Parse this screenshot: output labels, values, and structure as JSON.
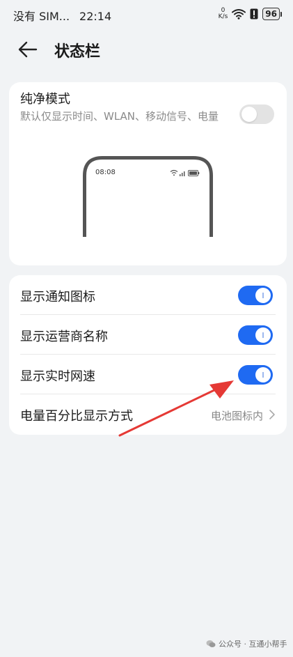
{
  "status_bar": {
    "carrier": "没有 SIM...",
    "time": "22:14",
    "net_speed_value": "0",
    "net_speed_unit": "K/s",
    "battery": "96"
  },
  "header": {
    "title": "状态栏"
  },
  "pure_mode": {
    "title": "纯净模式",
    "description": "默认仅显示时间、WLAN、移动信号、电量",
    "enabled": false,
    "preview_time": "08:08"
  },
  "settings": [
    {
      "label": "显示通知图标",
      "enabled": true
    },
    {
      "label": "显示运营商名称",
      "enabled": true
    },
    {
      "label": "显示实时网速",
      "enabled": true
    }
  ],
  "battery_display": {
    "label": "电量百分比显示方式",
    "value": "电池图标内"
  },
  "watermark": {
    "text": "公众号 · 互通小帮手"
  },
  "colors": {
    "accent": "#1f6af2",
    "annotation": "#e53935"
  }
}
